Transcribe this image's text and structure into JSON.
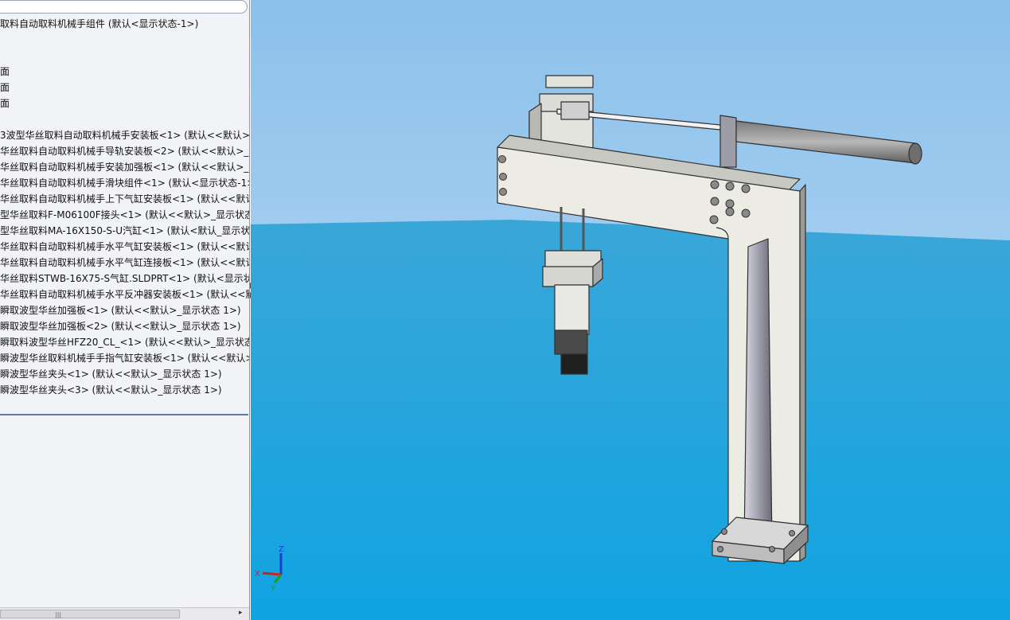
{
  "tree": {
    "root": "取料自动取料机械手组件 (默认<显示状态-1>)",
    "planes": [
      "面",
      "面",
      "面"
    ],
    "components": [
      "3波型华丝取料自动取料机械手安装板<1> (默认<<默认>_",
      "华丝取料自动取料机械手导轨安装板<2> (默认<<默认>_显",
      "华丝取料自动取料机械手安装加强板<1> (默认<<默认>_显",
      "华丝取料自动取料机械手滑块组件<1> (默认<显示状态-1>)",
      "华丝取料自动取料机械手上下气缸安装板<1> (默认<<默认",
      "型华丝取料F-M06100F接头<1> (默认<<默认>_显示状态",
      "型华丝取料MA-16X150-S-U汽缸<1> (默认<默认_显示状",
      "华丝取料自动取料机械手水平气缸安装板<1> (默认<<默认",
      "华丝取料自动取料机械手水平气缸连接板<1> (默认<<默认",
      "华丝取料STWB-16X75-S气缸.SLDPRT<1> (默认<显示状态",
      "华丝取料自动取料机械手水平反冲器安装板<1> (默认<<默",
      "瞬取波型华丝加强板<1> (默认<<默认>_显示状态 1>)",
      "瞬取波型华丝加强板<2> (默认<<默认>_显示状态 1>)",
      "瞬取料波型华丝HFZ20_CL_<1> (默认<<默认>_显示状态 1",
      "瞬波型华丝取料机械手手指气缸安装板<1> (默认<<默认>_",
      "瞬波型华丝夹头<1> (默认<<默认>_显示状态 1>)",
      "瞬波型华丝夹头<3> (默认<<默认>_显示状态 1>)"
    ]
  },
  "scrollbar": {
    "grip": "|||",
    "right_arrow": "▸"
  },
  "triad": {
    "z": "Z",
    "x": "X",
    "y": "Y"
  },
  "colors": {
    "sky_top": "#8cc0ea",
    "sky_bottom": "#c0e0f8",
    "floor_top": "#3aa6d8",
    "floor_bottom": "#10a4e2",
    "plate": "#ecebe4",
    "edge": "#303030"
  }
}
